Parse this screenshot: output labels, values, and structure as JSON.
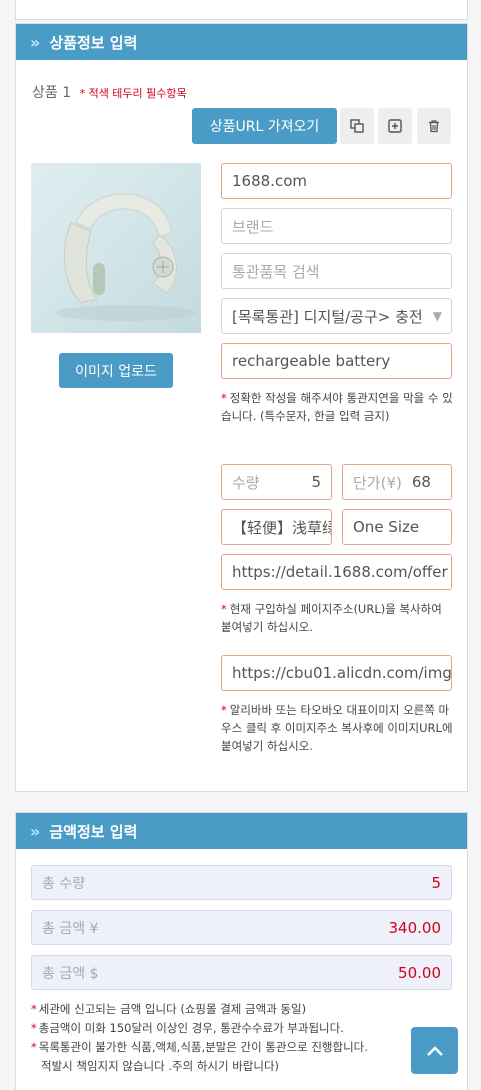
{
  "product_panel": {
    "title": "상품정보 입력",
    "product_label": "상품 1",
    "required_note": "* 적색 테두리 필수항목",
    "fetch_url_button": "상품URL 가져오기",
    "upload_button": "이미지 업로드",
    "fields": {
      "site": "1688.com",
      "brand_placeholder": "브랜드",
      "customs_item_placeholder": "통관품목 검색",
      "category_select": "[목록통관] 디지털/공구> 충전",
      "product_name": "rechargeable battery",
      "name_hint": "정확한 작성을 해주셔야 통관지연을 막을 수 있습니다. (특수문자, 한글 입력 금지)",
      "quantity_label": "수량",
      "quantity_value": "5",
      "unit_price_label": "단가(¥)",
      "unit_price_value": "68",
      "color_option": "【轻便】浅草绿",
      "size_option": "One Size",
      "page_url": "https://detail.1688.com/offer",
      "page_url_hint": "현재 구입하실 페이지주소(URL)을 복사하여 붙여넣기 하십시오.",
      "image_url": "https://cbu01.alicdn.com/img",
      "image_url_hint": "알리바바 또는 타오바오 대표이미지 오른쪽 마우스 클릭 후 이미지주소 복사후에 이미지URL에 붙여넣기 하십시오."
    }
  },
  "amount_panel": {
    "title": "금액정보 입력",
    "total_qty_label": "총 수량",
    "total_qty_value": "5",
    "total_yuan_label": "총 금액 ¥",
    "total_yuan_value": "340.00",
    "total_usd_label": "총 금액 $",
    "total_usd_value": "50.00",
    "notes": [
      "세관에 신고되는 금액 입니다 (쇼핑몰 결제 금액과 동일)",
      "총금액이 미화 150달러 이상인 경우, 통관수수료가 부과됩니다.",
      "목록통관이 불가한 식품,액체,식품,분말은 간이 통관으로 진행합니다.",
      "적발시 책임지지 않습니다 .주의 하시기 바랍니다)"
    ]
  },
  "icons": [
    "copy-icon",
    "add-icon",
    "trash-icon",
    "chevron-down-icon",
    "arrow-up-icon",
    "double-chevron-icon"
  ],
  "colors": {
    "accent": "#4a9cc7",
    "required_border": "#e8a28c",
    "alert_red": "#d0021b"
  }
}
